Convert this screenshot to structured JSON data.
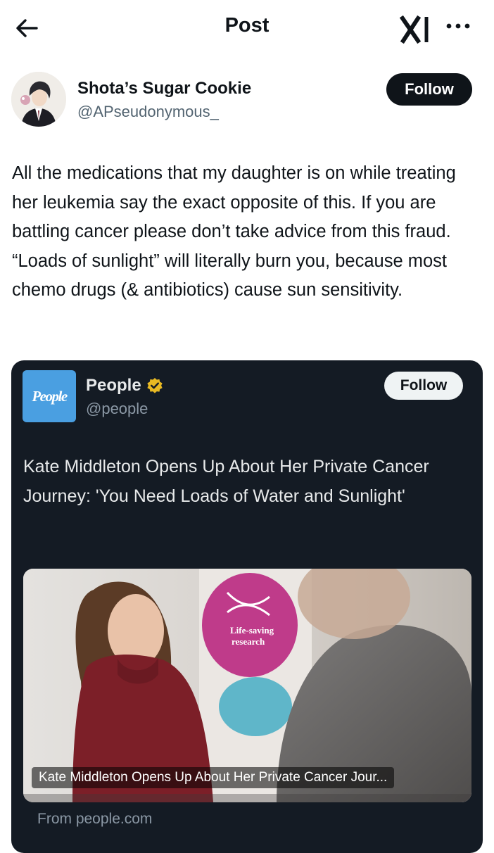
{
  "header": {
    "title": "Post",
    "back_icon": "back-arrow-icon",
    "logo_icon": "x-ai-logo-icon",
    "more_icon": "more-horizontal-icon"
  },
  "author": {
    "name": "Shota’s Sugar Cookie",
    "handle": "@APseudonymous_",
    "follow_label": "Follow"
  },
  "post": {
    "text": "All the medications that my daughter is on while treating her leukemia say the exact opposite of this. If you are battling cancer please don’t take advice from this fraud. “Loads of sunlight” will literally burn you, because most chemo drugs (& antibiotics) cause sun sensitivity."
  },
  "quote": {
    "logo_text": "People",
    "logo_color": "#4a9fe1",
    "name": "People",
    "verified_badge_color": "#e8b923",
    "handle": "@people",
    "follow_label": "Follow",
    "text": "Kate Middleton Opens Up About Her Private Cancer Journey: 'You Need Loads of Water and Sunlight'",
    "media": {
      "caption": "Kate Middleton Opens Up About Her Private Cancer Jour...",
      "banner_text_1": "Life-saving",
      "banner_text_2": "research"
    },
    "source": "From people.com"
  },
  "colors": {
    "card_bg": "#141b24",
    "primary_text": "#0f1419",
    "secondary_text": "#536471"
  }
}
